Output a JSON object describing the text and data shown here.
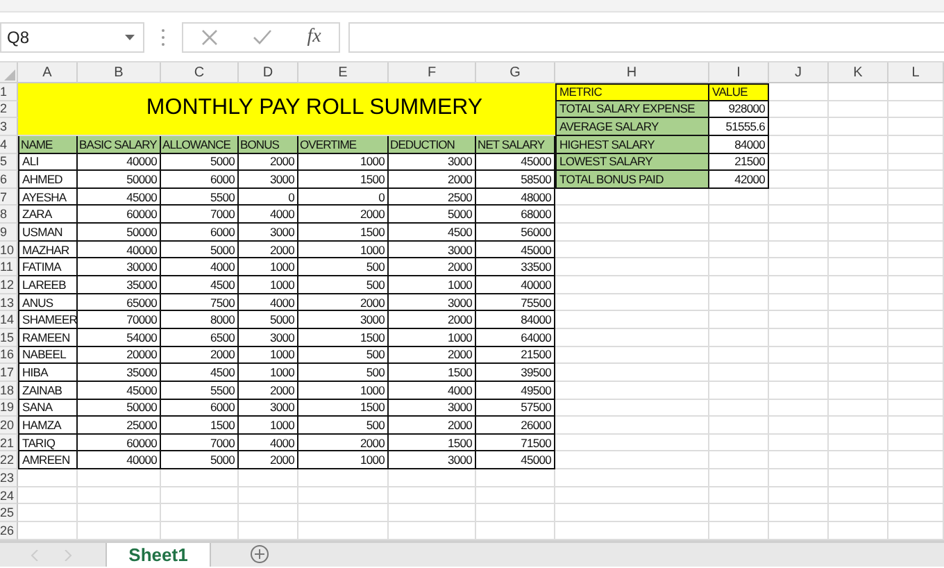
{
  "name_box": "Q8",
  "formula_bar": {
    "function_label": "fx"
  },
  "column_headers": [
    "A",
    "B",
    "C",
    "D",
    "E",
    "F",
    "G",
    "H",
    "I",
    "J",
    "K",
    "L"
  ],
  "row_headers": [
    "1",
    "2",
    "3",
    "4",
    "5",
    "6",
    "7",
    "8",
    "9",
    "10",
    "11",
    "12",
    "13",
    "14",
    "15",
    "16",
    "17",
    "18",
    "19",
    "20",
    "21",
    "22",
    "23",
    "24",
    "25",
    "26"
  ],
  "payroll": {
    "title": "MONTHLY PAY ROLL SUMMERY",
    "columns": [
      "NAME",
      "BASIC SALARY",
      "ALLOWANCE",
      "BONUS",
      "OVERTIME",
      "DEDUCTION",
      "NET SALARY"
    ],
    "rows": [
      [
        "ALI",
        "40000",
        "5000",
        "2000",
        "1000",
        "3000",
        "45000"
      ],
      [
        "AHMED",
        "50000",
        "6000",
        "3000",
        "1500",
        "2000",
        "58500"
      ],
      [
        "AYESHA",
        "45000",
        "5500",
        "0",
        "0",
        "2500",
        "48000"
      ],
      [
        "ZARA",
        "60000",
        "7000",
        "4000",
        "2000",
        "5000",
        "68000"
      ],
      [
        "USMAN",
        "50000",
        "6000",
        "3000",
        "1500",
        "4500",
        "56000"
      ],
      [
        "MAZHAR",
        "40000",
        "5000",
        "2000",
        "1000",
        "3000",
        "45000"
      ],
      [
        "FATIMA",
        "30000",
        "4000",
        "1000",
        "500",
        "2000",
        "33500"
      ],
      [
        "LAREEB",
        "35000",
        "4500",
        "1000",
        "500",
        "1000",
        "40000"
      ],
      [
        "ANUS",
        "65000",
        "7500",
        "4000",
        "2000",
        "3000",
        "75500"
      ],
      [
        "SHAMEER",
        "70000",
        "8000",
        "5000",
        "3000",
        "2000",
        "84000"
      ],
      [
        "RAMEEN",
        "54000",
        "6500",
        "3000",
        "1500",
        "1000",
        "64000"
      ],
      [
        "NABEEL",
        "20000",
        "2000",
        "1000",
        "500",
        "2000",
        "21500"
      ],
      [
        "HIBA",
        "35000",
        "4500",
        "1000",
        "500",
        "1500",
        "39500"
      ],
      [
        "ZAINAB",
        "45000",
        "5500",
        "2000",
        "1000",
        "4000",
        "49500"
      ],
      [
        "SANA",
        "50000",
        "6000",
        "3000",
        "1500",
        "3000",
        "57500"
      ],
      [
        "HAMZA",
        "25000",
        "1500",
        "1000",
        "500",
        "2000",
        "26000"
      ],
      [
        "TARIQ",
        "60000",
        "7000",
        "4000",
        "2000",
        "1500",
        "71500"
      ],
      [
        "AMREEN",
        "40000",
        "5000",
        "2000",
        "1000",
        "3000",
        "45000"
      ]
    ]
  },
  "metrics": {
    "columns": [
      "METRIC",
      "VALUE"
    ],
    "rows": [
      [
        "TOTAL SALARY EXPENSE",
        "928000"
      ],
      [
        "AVERAGE SALARY",
        "51555.6"
      ],
      [
        "HIGHEST SALARY",
        "84000"
      ],
      [
        "LOWEST SALARY",
        "21500"
      ],
      [
        "TOTAL BONUS PAID",
        "42000"
      ]
    ]
  },
  "sheet_tabs": [
    {
      "label": "Sheet1",
      "selected": true
    }
  ]
}
